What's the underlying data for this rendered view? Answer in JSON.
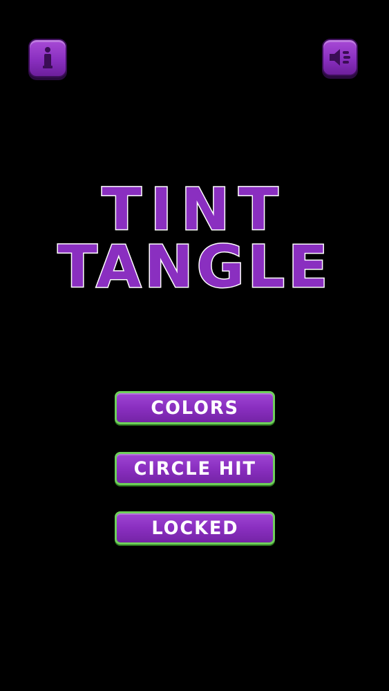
{
  "header": {
    "info_icon": "info-icon",
    "sound_icon": "speaker-icon"
  },
  "title": {
    "line1": "TINT",
    "line2": "TANGLE"
  },
  "menu": {
    "items": [
      {
        "label": "COLORS"
      },
      {
        "label": "CIRCLE HIT"
      },
      {
        "label": "LOCKED"
      }
    ]
  },
  "colors": {
    "background": "#000000",
    "button_purple": "#8a2fc0",
    "button_border_green": "#6ed05a",
    "title_fill": "#8a2fc0",
    "title_stroke": "#ffffff"
  }
}
